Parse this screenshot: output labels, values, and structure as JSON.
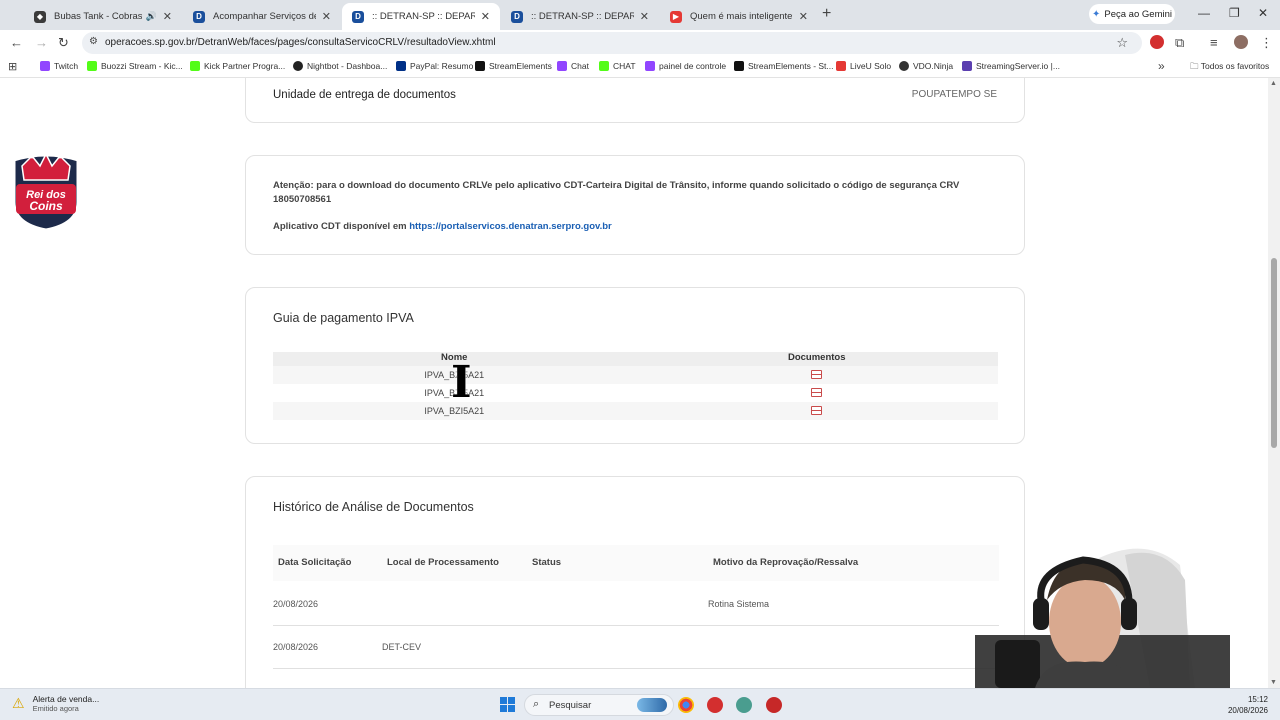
{
  "browser": {
    "tabs": [
      {
        "title": "Bubas Tank - Cobras — Baixo",
        "favicon_color": "#3a3a3a"
      },
      {
        "title": "Acompanhar Serviços de Veículos",
        "favicon_color": "#1a4f9c"
      },
      {
        "title": ":: DETRAN-SP :: DEPARTAMENTO",
        "favicon_color": "#1a4f9c",
        "active": true
      },
      {
        "title": ":: DETRAN-SP :: DEPARTAMENTO",
        "favicon_color": "#1a4f9c"
      },
      {
        "title": "Quem é mais inteligente? Engenh",
        "favicon_color": "#e53935"
      }
    ],
    "gemini_label": "Peça ao Gemini",
    "url": "operacoes.sp.gov.br/DetranWeb/faces/pages/consultaServicoCRLV/resultadoView.xhtml",
    "bookmarks": [
      {
        "label": "Twitch",
        "color": "#9146ff"
      },
      {
        "label": "Buozzi Stream - Kic...",
        "color": "#53fc18"
      },
      {
        "label": "Kick Partner Progra...",
        "color": "#53fc18"
      },
      {
        "label": "Nightbot - Dashboa...",
        "color": "#222222"
      },
      {
        "label": "PayPal: Resumo",
        "color": "#003087"
      },
      {
        "label": "StreamElements",
        "color": "#111111"
      },
      {
        "label": "Chat",
        "color": "#9146ff"
      },
      {
        "label": "CHAT",
        "color": "#53fc18"
      },
      {
        "label": "painel de controle",
        "color": "#9146ff"
      },
      {
        "label": "StreamElements - St...",
        "color": "#111111"
      },
      {
        "label": "LiveU Solo",
        "color": "#e53935"
      },
      {
        "label": "VDO.Ninja",
        "color": "#333333"
      },
      {
        "label": "StreamingServer.io |...",
        "color": "#5b3fb0"
      }
    ],
    "bookmarks_all": "Todos os favoritos"
  },
  "page": {
    "unidade_label": "Unidade de entrega de documentos",
    "unidade_value": "POUPATEMPO SE",
    "atencao_text": "Atenção: para o download do documento CRLVe pelo aplicativo CDT-Carteira Digital de Trânsito, informe quando solicitado o código de segurança CRV 18050708561",
    "app_prefix": "Aplicativo CDT disponível em ",
    "app_link": "https://portalservicos.denatran.serpro.gov.br",
    "ipva": {
      "heading": "Guia de pagamento IPVA",
      "col_nome": "Nome",
      "col_documentos": "Documentos",
      "rows": [
        "IPVA_BZI5A21",
        "IPVA_BZI5A21",
        "IPVA_BZI5A21"
      ]
    },
    "historico": {
      "heading": "Histórico de Análise de Documentos",
      "col_data": "Data Solicitação",
      "col_local": "Local de Processamento",
      "col_status": "Status",
      "col_motivo": "Motivo da Reprovação/Ressalva",
      "rows": [
        {
          "data": "20/08/2026",
          "local": "",
          "status": "",
          "motivo": "Rotina Sistema"
        },
        {
          "data": "20/08/2026",
          "local": "DET-CEV",
          "status": "",
          "motivo": ""
        }
      ]
    }
  },
  "logo": {
    "line1": "Rei dos",
    "line2": "Coins"
  },
  "taskbar": {
    "notif_title": "Alerta de venda...",
    "notif_sub": "Emitido agora",
    "search_placeholder": "Pesquisar",
    "time": "15:12",
    "date": "20/08/2026"
  }
}
